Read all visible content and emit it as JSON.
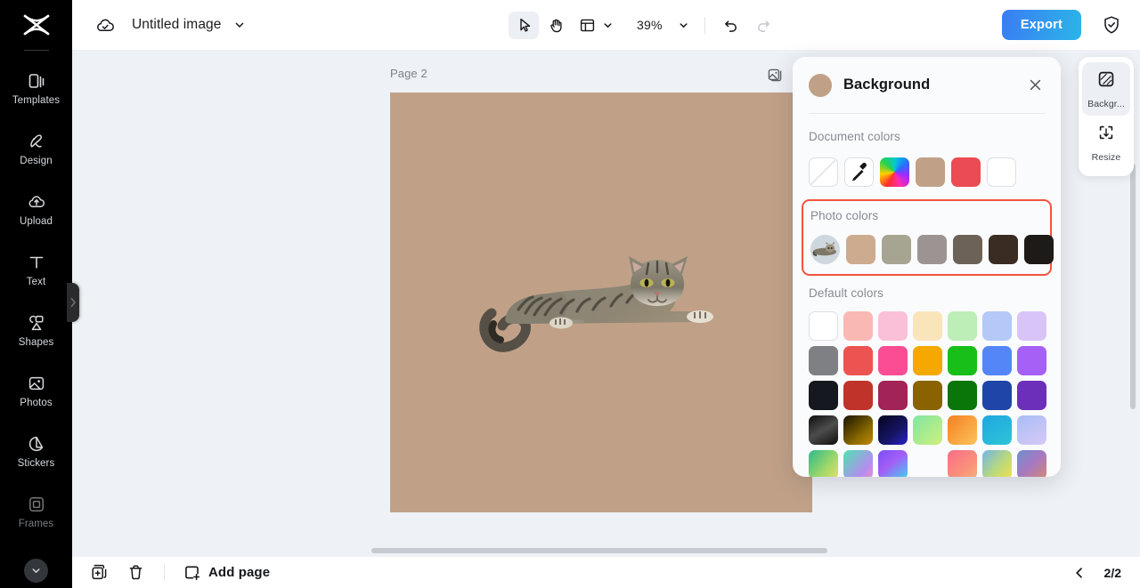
{
  "app": {
    "brand": "capcut-logo"
  },
  "topbar": {
    "cloud_icon": "cloud-check-icon",
    "doc_title": "Untitled image",
    "title_caret_icon": "chevron-down-icon",
    "tools": [
      {
        "name": "select-tool",
        "icon": "cursor-arrow-icon",
        "active": true
      },
      {
        "name": "hand-tool",
        "icon": "hand-icon",
        "active": false
      },
      {
        "name": "layout-tool",
        "icon": "layout-grid-icon",
        "active": false
      }
    ],
    "layout_caret_icon": "chevron-down-icon",
    "zoom_value": "39%",
    "zoom_caret_icon": "chevron-down-icon",
    "undo_icon": "undo-arrow-icon",
    "redo_icon": "redo-arrow-icon",
    "export_label": "Export",
    "export_gradient_from": "#3a7cf3",
    "export_gradient_to": "#2bb5e8",
    "shield_icon": "shield-check-icon"
  },
  "sidebar": {
    "items": [
      {
        "label": "Templates",
        "icon": "templates-icon",
        "dim": false
      },
      {
        "label": "Design",
        "icon": "design-icon",
        "dim": false
      },
      {
        "label": "Upload",
        "icon": "upload-cloud-icon",
        "dim": false
      },
      {
        "label": "Text",
        "icon": "text-t-icon",
        "dim": false
      },
      {
        "label": "Shapes",
        "icon": "shapes-icon",
        "dim": false
      },
      {
        "label": "Photos",
        "icon": "photos-image-icon",
        "dim": false
      },
      {
        "label": "Stickers",
        "icon": "sticker-icon",
        "dim": false
      },
      {
        "label": "Frames",
        "icon": "frames-icon",
        "dim": true
      }
    ],
    "more_icon": "chevron-down-icon",
    "collapse_handle_icon": "chevron-right-icon"
  },
  "stage": {
    "page_label": "Page 2",
    "page_images_icon": "stacked-images-icon",
    "artboard_background": "#c0a188",
    "photo_alt": "tabby-cat-lying-down",
    "h_scrollbar": "horizontal-scrollbar",
    "v_scrollbar": "vertical-scrollbar"
  },
  "right_dock": {
    "items": [
      {
        "label": "Backgr...",
        "icon": "background-swatch-icon",
        "active": true
      },
      {
        "label": "Resize",
        "icon": "resize-frame-icon",
        "active": false
      }
    ]
  },
  "background_panel": {
    "header_swatch": "#c0a188",
    "title": "Background",
    "close_icon": "close-x-icon",
    "document_colors": {
      "title": "Document colors",
      "swatches": [
        {
          "name": "transparent-swatch",
          "type": "none",
          "color": "#ffffff"
        },
        {
          "name": "eyedropper-swatch",
          "type": "picker",
          "color": "#ffffff"
        },
        {
          "name": "rainbow-swatch",
          "type": "rainbow",
          "color": "#ff00ff"
        },
        {
          "name": "tan-swatch",
          "type": "solid",
          "color": "#c0a188"
        },
        {
          "name": "red-swatch",
          "type": "solid",
          "color": "#eb4b52"
        },
        {
          "name": "white-swatch",
          "type": "solid",
          "color": "#ffffff"
        }
      ]
    },
    "photo_colors": {
      "title": "Photo colors",
      "highlighted": true,
      "highlight_color": "#f4533e",
      "thumbnail": "photo-thumbnail-cat",
      "swatches": [
        {
          "name": "photo-color-1",
          "color": "#cdab8f"
        },
        {
          "name": "photo-color-2",
          "color": "#a8a492"
        },
        {
          "name": "photo-color-3",
          "color": "#9c9492"
        },
        {
          "name": "photo-color-4",
          "color": "#6d6257"
        },
        {
          "name": "photo-color-5",
          "color": "#3a2b23"
        },
        {
          "name": "photo-color-6",
          "color": "#1e1a18"
        }
      ]
    },
    "default_colors": {
      "title": "Default colors",
      "swatches": [
        {
          "name": "white",
          "color": "#ffffff",
          "bordered": true
        },
        {
          "name": "light-salmon",
          "color": "#fab8b4"
        },
        {
          "name": "light-pink",
          "color": "#fac0d8"
        },
        {
          "name": "light-cream",
          "color": "#fae5bb"
        },
        {
          "name": "light-green",
          "color": "#bdeeb7"
        },
        {
          "name": "light-blue",
          "color": "#b4c9f8"
        },
        {
          "name": "light-purple",
          "color": "#d9c4f8"
        },
        {
          "name": "gray",
          "color": "#7e8084"
        },
        {
          "name": "red",
          "color": "#eb5450"
        },
        {
          "name": "pink",
          "color": "#fa4d94"
        },
        {
          "name": "orange",
          "color": "#f5a800"
        },
        {
          "name": "green",
          "color": "#18bf18"
        },
        {
          "name": "blue",
          "color": "#5486f7"
        },
        {
          "name": "purple",
          "color": "#a560f5"
        },
        {
          "name": "near-black",
          "color": "#16181f"
        },
        {
          "name": "dark-red",
          "color": "#c0332a"
        },
        {
          "name": "maroon",
          "color": "#a22355"
        },
        {
          "name": "dark-gold",
          "color": "#8a6300"
        },
        {
          "name": "dark-green",
          "color": "#0a7508"
        },
        {
          "name": "navy-blue",
          "color": "#1f45a8"
        },
        {
          "name": "dark-purple",
          "color": "#6b2fba"
        },
        {
          "name": "gradient-charcoal",
          "gradient": "linear-gradient(150deg,#0e0e0e 0%,#4d4d4d 50%,#0e0e0e 100%)"
        },
        {
          "name": "gradient-gold",
          "gradient": "linear-gradient(140deg,#181200 0%,#8a6a00 65%,#c08a00 100%)"
        },
        {
          "name": "gradient-indigo",
          "gradient": "linear-gradient(140deg,#05051e 0%,#171566 60%,#2a22cc 100%)"
        },
        {
          "name": "gradient-mint",
          "gradient": "linear-gradient(135deg,#7fe6a4 0%,#cff07a 100%)"
        },
        {
          "name": "gradient-orange",
          "gradient": "linear-gradient(135deg,#f58020 0%,#fbc35c 100%)"
        },
        {
          "name": "gradient-sky",
          "gradient": "linear-gradient(150deg,#1ea7e0 0%,#2ec5d8 100%)"
        },
        {
          "name": "gradient-periwinkle",
          "gradient": "linear-gradient(150deg,#a9bdf5 0%,#d6c9f7 100%)"
        },
        {
          "name": "gradient-teal-lime",
          "gradient": "linear-gradient(130deg,#2fb98a 0%,#9fd86a 60%,#e7e06a 100%)"
        },
        {
          "name": "gradient-aqua-pink",
          "gradient": "linear-gradient(130deg,#4fe3b0 0%,#b38df0 70%,#e88fd0 100%)"
        },
        {
          "name": "gradient-violet-cyan",
          "gradient": "linear-gradient(140deg,#7b4ef7 0%,#a35ef5 45%,#3fd3f0 100%)"
        },
        {
          "name": "gradient-plum",
          "gradient": "linear-gradient(135deg,#8e62d8 0%,#c playing 50%,#d45ea8 100%)"
        },
        {
          "name": "gradient-coral",
          "gradient": "linear-gradient(140deg,#f76e8a 0%,#fa8f7a 60%,#f6b07d 100%)"
        },
        {
          "name": "gradient-blue-yellow",
          "gradient": "linear-gradient(130deg,#6fb6e8 0%,#b9d87e 55%,#f2e24a 100%)"
        },
        {
          "name": "gradient-mauve",
          "gradient": "linear-gradient(135deg,#6f8fd0 0%,#a878c0 50%,#d48a70 100%)"
        }
      ]
    }
  },
  "bottombar": {
    "duplicate_icon": "duplicate-page-icon",
    "delete_icon": "trash-icon",
    "add_page_icon": "add-page-icon",
    "add_page_label": "Add page",
    "prev_page_icon": "chevron-left-icon",
    "page_counter": "2/2"
  }
}
